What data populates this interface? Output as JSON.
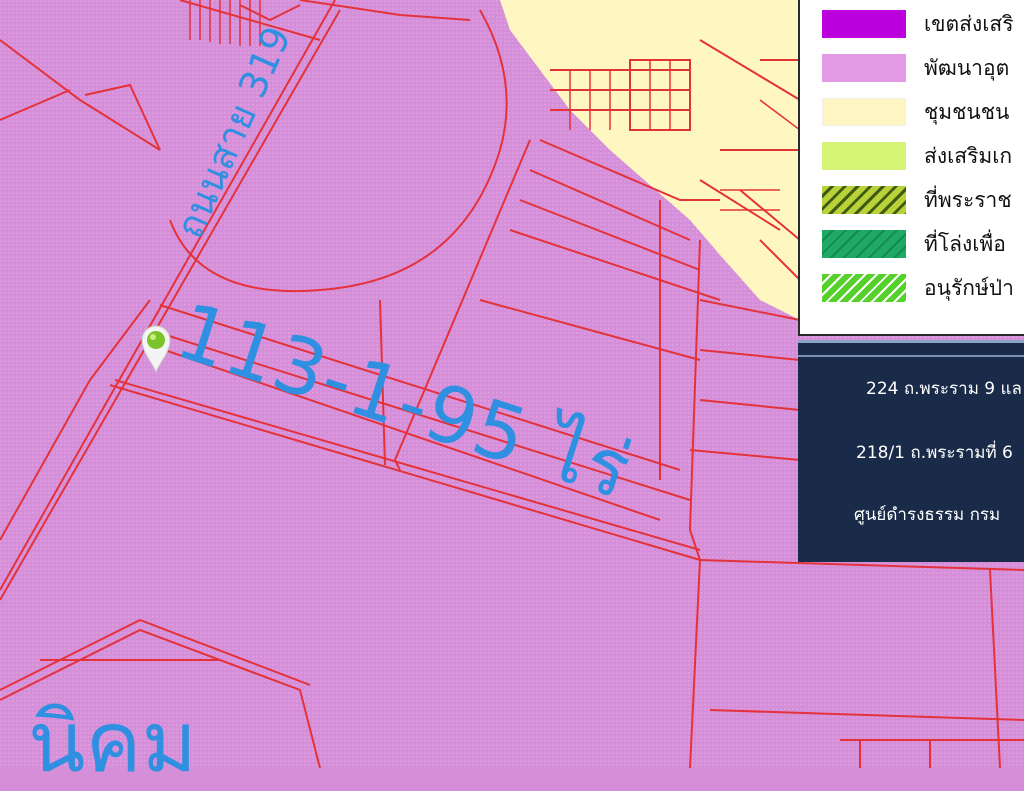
{
  "map": {
    "area_label": "113-1-95 ไร่",
    "road_label": "ถนนสาย 319",
    "bottom_label": "นิคม",
    "colors": {
      "industrial": "#d58fd8",
      "community": "#fff7c2",
      "parcel_line": "#e3323a",
      "label": "#2f8fe0"
    },
    "pin_icon": "location-pin-icon"
  },
  "legend": {
    "items": [
      {
        "label": "เขตส่งเสริ",
        "swatch_color": "#bb00dd",
        "pattern": "solid"
      },
      {
        "label": "พัฒนาอุต",
        "swatch_color": "#e49be6",
        "pattern": "solid"
      },
      {
        "label": "ชุมชนชน",
        "swatch_color": "#fff6c4",
        "pattern": "solid"
      },
      {
        "label": "ส่งเสริมเก",
        "swatch_color": "#d6f575",
        "pattern": "solid"
      },
      {
        "label": "ที่พระราช",
        "swatch_color": "#b9d23a",
        "pattern": "hatch"
      },
      {
        "label": "ที่โล่งเพื่อ",
        "swatch_color": "#1fa866",
        "pattern": "hatch"
      },
      {
        "label": "อนุรักษ์ป่า",
        "swatch_color": "#56d12b",
        "pattern": "hatch"
      }
    ]
  },
  "info": {
    "lines": [
      "224 ถ.พระราม 9 แล",
      "218/1 ถ.พระรามที่ 6",
      "ศูนย์ดำรงธรรม กรม"
    ],
    "panel_color": "#1a2b4a"
  }
}
